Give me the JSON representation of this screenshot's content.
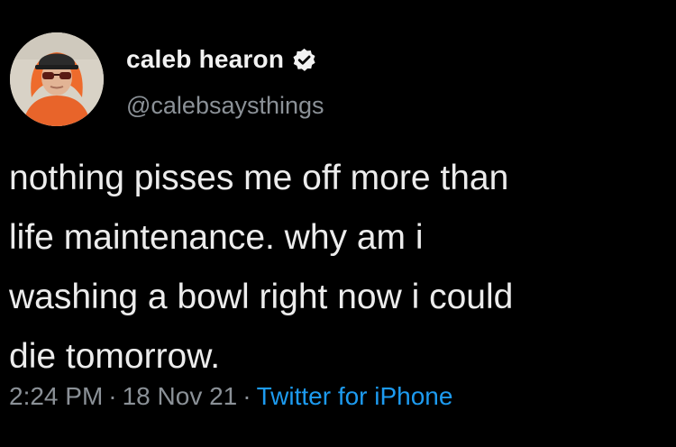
{
  "author": {
    "display_name": "caleb hearon",
    "handle": "@calebsaysthings",
    "verified": true,
    "avatar_icon": "profile-photo"
  },
  "tweet": {
    "lines": [
      "nothing pisses me off more than",
      "life maintenance. why am i",
      "washing a bowl right now i could",
      "die tomorrow."
    ]
  },
  "meta": {
    "time": "2:24 PM",
    "separator": "·",
    "date": "18 Nov 21",
    "source": "Twitter for iPhone"
  },
  "colors": {
    "background": "#000000",
    "text": "#ececec",
    "muted": "#8b9197",
    "link": "#1d9bf0"
  }
}
